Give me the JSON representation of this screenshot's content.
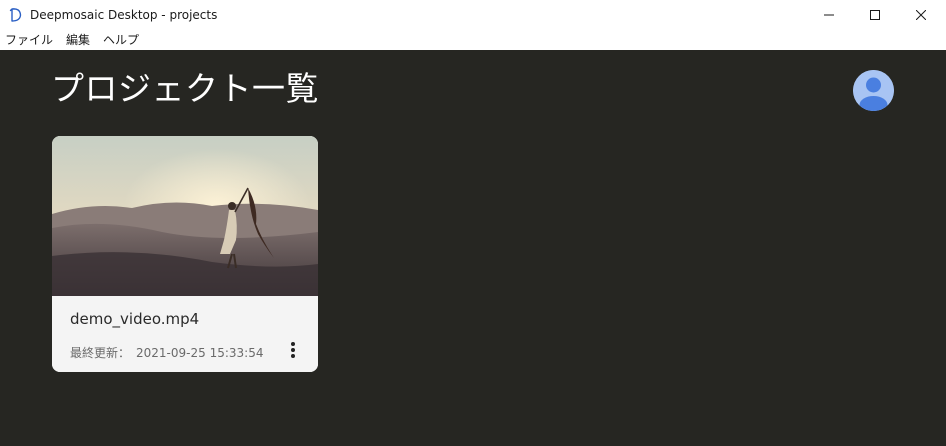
{
  "window": {
    "title": "Deepmosaic Desktop - projects",
    "logo_icon": "deepmosaic-logo-icon",
    "controls": [
      "minimize-icon",
      "maximize-icon",
      "close-icon"
    ]
  },
  "menu": {
    "items": [
      {
        "label": "ファイル"
      },
      {
        "label": "編集"
      },
      {
        "label": "ヘルプ"
      }
    ]
  },
  "header": {
    "title": "プロジェクト一覧",
    "avatar_icon": "user-avatar-icon"
  },
  "projects": [
    {
      "filename": "demo_video.mp4",
      "updated_label": "最終更新：",
      "updated_at": "2021-09-25 15:33:54",
      "menu_icon": "more-vertical-icon"
    }
  ],
  "colors": {
    "background": "#262622",
    "card": "#f4f4f4",
    "title_text": "#ffffff",
    "avatar_bg": "#a8c4f3",
    "avatar_fg": "#4a7fe0"
  }
}
